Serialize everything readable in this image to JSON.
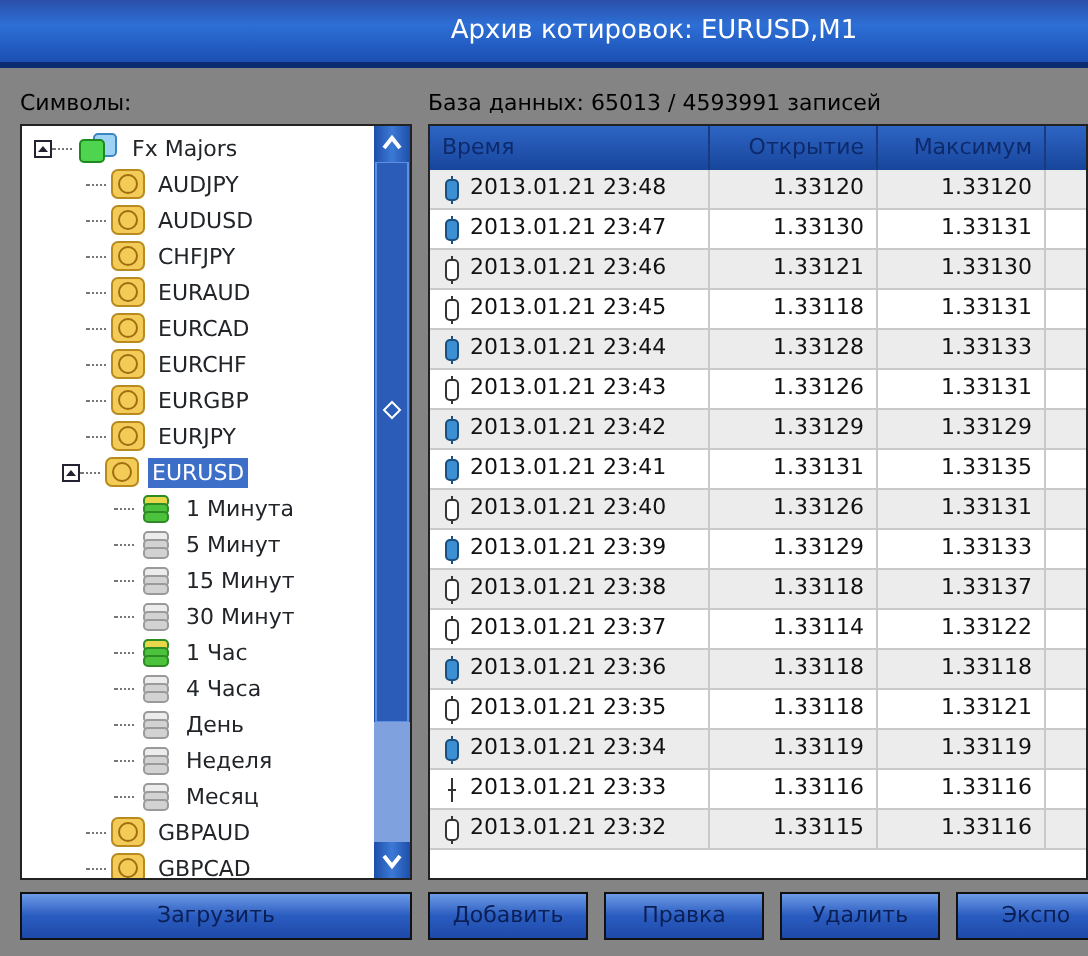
{
  "window": {
    "title": "Архив котировок: EURUSD,M1"
  },
  "symbols_label": "Символы:",
  "database_label": "База данных: 65013 / 4593991 записей",
  "tree": [
    {
      "label": "Fx Majors",
      "kind": "group",
      "selected": false,
      "children": [
        {
          "label": "AUDJPY",
          "kind": "symbol",
          "selected": false
        },
        {
          "label": "AUDUSD",
          "kind": "symbol",
          "selected": false
        },
        {
          "label": "CHFJPY",
          "kind": "symbol",
          "selected": false
        },
        {
          "label": "EURAUD",
          "kind": "symbol",
          "selected": false
        },
        {
          "label": "EURCAD",
          "kind": "symbol",
          "selected": false
        },
        {
          "label": "EURCHF",
          "kind": "symbol",
          "selected": false
        },
        {
          "label": "EURGBP",
          "kind": "symbol",
          "selected": false
        },
        {
          "label": "EURJPY",
          "kind": "symbol",
          "selected": false
        },
        {
          "label": "EURUSD",
          "kind": "symbol",
          "selected": true,
          "children": [
            {
              "label": "1 Минута",
              "kind": "period",
              "has_data": true,
              "selected": false
            },
            {
              "label": "5 Минут",
              "kind": "period",
              "has_data": false,
              "selected": false
            },
            {
              "label": "15 Минут",
              "kind": "period",
              "has_data": false,
              "selected": false
            },
            {
              "label": "30 Минут",
              "kind": "period",
              "has_data": false,
              "selected": false
            },
            {
              "label": "1 Час",
              "kind": "period",
              "has_data": true,
              "selected": false
            },
            {
              "label": "4 Часа",
              "kind": "period",
              "has_data": false,
              "selected": false
            },
            {
              "label": "День",
              "kind": "period",
              "has_data": false,
              "selected": false
            },
            {
              "label": "Неделя",
              "kind": "period",
              "has_data": false,
              "selected": false
            },
            {
              "label": "Месяц",
              "kind": "period",
              "has_data": false,
              "selected": false
            }
          ]
        },
        {
          "label": "GBPAUD",
          "kind": "symbol",
          "selected": false
        },
        {
          "label": "GBPCAD",
          "kind": "symbol",
          "selected": false
        }
      ]
    }
  ],
  "table": {
    "columns": [
      "Время",
      "Открытие",
      "Максимум"
    ],
    "rows": [
      {
        "kind": "bull",
        "time": "2013.01.21 23:48",
        "open": "1.33120",
        "high": "1.33120"
      },
      {
        "kind": "bull",
        "time": "2013.01.21 23:47",
        "open": "1.33130",
        "high": "1.33131"
      },
      {
        "kind": "bear",
        "time": "2013.01.21 23:46",
        "open": "1.33121",
        "high": "1.33130"
      },
      {
        "kind": "bear",
        "time": "2013.01.21 23:45",
        "open": "1.33118",
        "high": "1.33131"
      },
      {
        "kind": "bull",
        "time": "2013.01.21 23:44",
        "open": "1.33128",
        "high": "1.33133"
      },
      {
        "kind": "bear",
        "time": "2013.01.21 23:43",
        "open": "1.33126",
        "high": "1.33131"
      },
      {
        "kind": "bull",
        "time": "2013.01.21 23:42",
        "open": "1.33129",
        "high": "1.33129"
      },
      {
        "kind": "bull",
        "time": "2013.01.21 23:41",
        "open": "1.33131",
        "high": "1.33135"
      },
      {
        "kind": "bear",
        "time": "2013.01.21 23:40",
        "open": "1.33126",
        "high": "1.33131"
      },
      {
        "kind": "bull",
        "time": "2013.01.21 23:39",
        "open": "1.33129",
        "high": "1.33133"
      },
      {
        "kind": "bear",
        "time": "2013.01.21 23:38",
        "open": "1.33118",
        "high": "1.33137"
      },
      {
        "kind": "bear",
        "time": "2013.01.21 23:37",
        "open": "1.33114",
        "high": "1.33122"
      },
      {
        "kind": "bull",
        "time": "2013.01.21 23:36",
        "open": "1.33118",
        "high": "1.33118"
      },
      {
        "kind": "bear",
        "time": "2013.01.21 23:35",
        "open": "1.33118",
        "high": "1.33121"
      },
      {
        "kind": "bull",
        "time": "2013.01.21 23:34",
        "open": "1.33119",
        "high": "1.33119"
      },
      {
        "kind": "doji",
        "time": "2013.01.21 23:33",
        "open": "1.33116",
        "high": "1.33116"
      },
      {
        "kind": "bear",
        "time": "2013.01.21 23:32",
        "open": "1.33115",
        "high": "1.33116"
      }
    ]
  },
  "buttons": [
    "Загрузить",
    "Добавить",
    "Правка",
    "Удалить",
    "Экспо"
  ]
}
